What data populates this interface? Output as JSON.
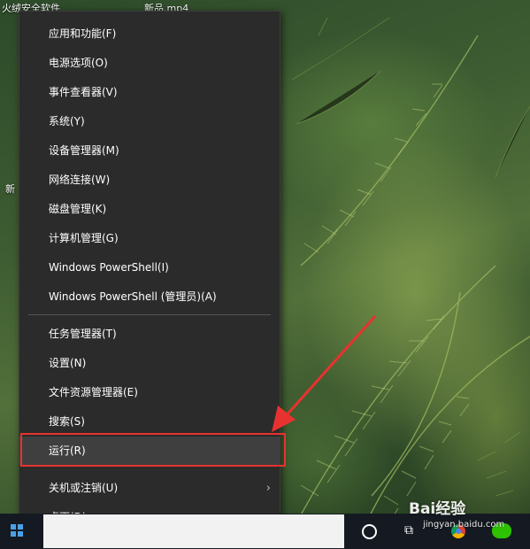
{
  "desktop": {
    "labels": [
      "火绒安全软件",
      "新品.mp4",
      "新"
    ]
  },
  "context_menu": {
    "items": [
      {
        "label": "应用和功能(F)"
      },
      {
        "label": "电源选项(O)"
      },
      {
        "label": "事件查看器(V)"
      },
      {
        "label": "系统(Y)"
      },
      {
        "label": "设备管理器(M)"
      },
      {
        "label": "网络连接(W)"
      },
      {
        "label": "磁盘管理(K)"
      },
      {
        "label": "计算机管理(G)"
      },
      {
        "label": "Windows PowerShell(I)"
      },
      {
        "label": "Windows PowerShell (管理员)(A)"
      },
      {
        "label": "任务管理器(T)"
      },
      {
        "label": "设置(N)"
      },
      {
        "label": "文件资源管理器(E)"
      },
      {
        "label": "搜索(S)"
      },
      {
        "label": "运行(R)"
      },
      {
        "label": "关机或注销(U)",
        "submenu_icon": "chevron-right-icon"
      },
      {
        "label": "桌面(D)"
      }
    ],
    "hovered_item": "运行(R)"
  },
  "annotation": {
    "highlight_color": "#e8322f",
    "arrow_color": "#e8322f"
  },
  "watermark": {
    "brand": "Bai经验",
    "url": "jingyan.baidu.com"
  },
  "taskbar": {
    "icons": [
      "windows-start-icon",
      "cortana-icon",
      "task-view-icon",
      "chrome-icon",
      "wechat-icon"
    ]
  }
}
